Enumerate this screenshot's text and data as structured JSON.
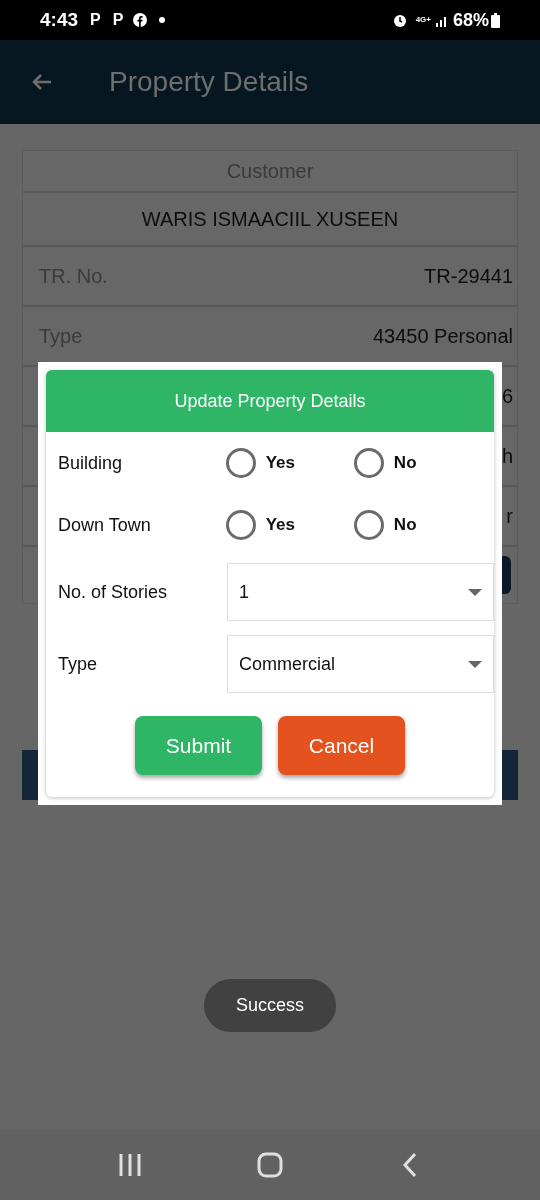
{
  "status_bar": {
    "time": "4:43",
    "notification_letters": [
      "P",
      "P"
    ],
    "battery": "68%",
    "network": "4G+"
  },
  "app_bar": {
    "title": "Property Details"
  },
  "card": {
    "header": "Customer",
    "customer_name": "WARIS ISMAACIIL XUSEEN",
    "rows": [
      {
        "label": "TR. No.",
        "value": "TR-29441"
      },
      {
        "label": "Type",
        "value": "43450 Personal"
      },
      {
        "value": "6"
      },
      {
        "value": "h"
      },
      {
        "value": "r"
      }
    ]
  },
  "dialog": {
    "title": "Update Property Details",
    "radio_rows": [
      {
        "label": "Building",
        "options": [
          {
            "label": "Yes",
            "selected": false
          },
          {
            "label": "No",
            "selected": false
          }
        ]
      },
      {
        "label": "Down Town",
        "options": [
          {
            "label": "Yes",
            "selected": false
          },
          {
            "label": "No",
            "selected": false
          }
        ]
      }
    ],
    "dropdowns": [
      {
        "label": "No. of Stories",
        "value": "1"
      },
      {
        "label": "Type",
        "value": "Commercial"
      }
    ],
    "buttons": [
      {
        "label": "Submit",
        "kind": "primary"
      },
      {
        "label": "Cancel",
        "kind": "danger"
      }
    ]
  },
  "toast": "Success"
}
